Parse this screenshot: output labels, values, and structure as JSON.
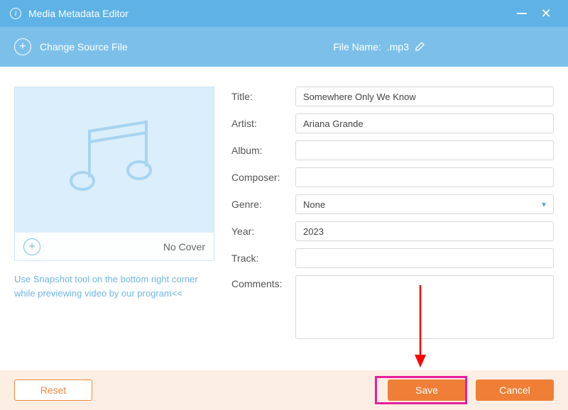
{
  "titlebar": {
    "title": "Media Metadata Editor"
  },
  "toolbar": {
    "change_source": "Change Source File",
    "filename_label": "File Name:",
    "filename_value": ".mp3"
  },
  "cover": {
    "no_cover": "No Cover",
    "hint": "Use Snapshot tool on the bottom right corner while previewing video by our program<<"
  },
  "form": {
    "labels": {
      "title": "Title:",
      "artist": "Artist:",
      "album": "Album:",
      "composer": "Composer:",
      "genre": "Genre:",
      "year": "Year:",
      "track": "Track:",
      "comments": "Comments:"
    },
    "values": {
      "title": "Somewhere Only We Know",
      "artist": "Ariana Grande",
      "album": "",
      "composer": "",
      "genre": "None",
      "year": "2023",
      "track": "",
      "comments": ""
    }
  },
  "footer": {
    "reset": "Reset",
    "save": "Save",
    "cancel": "Cancel"
  }
}
